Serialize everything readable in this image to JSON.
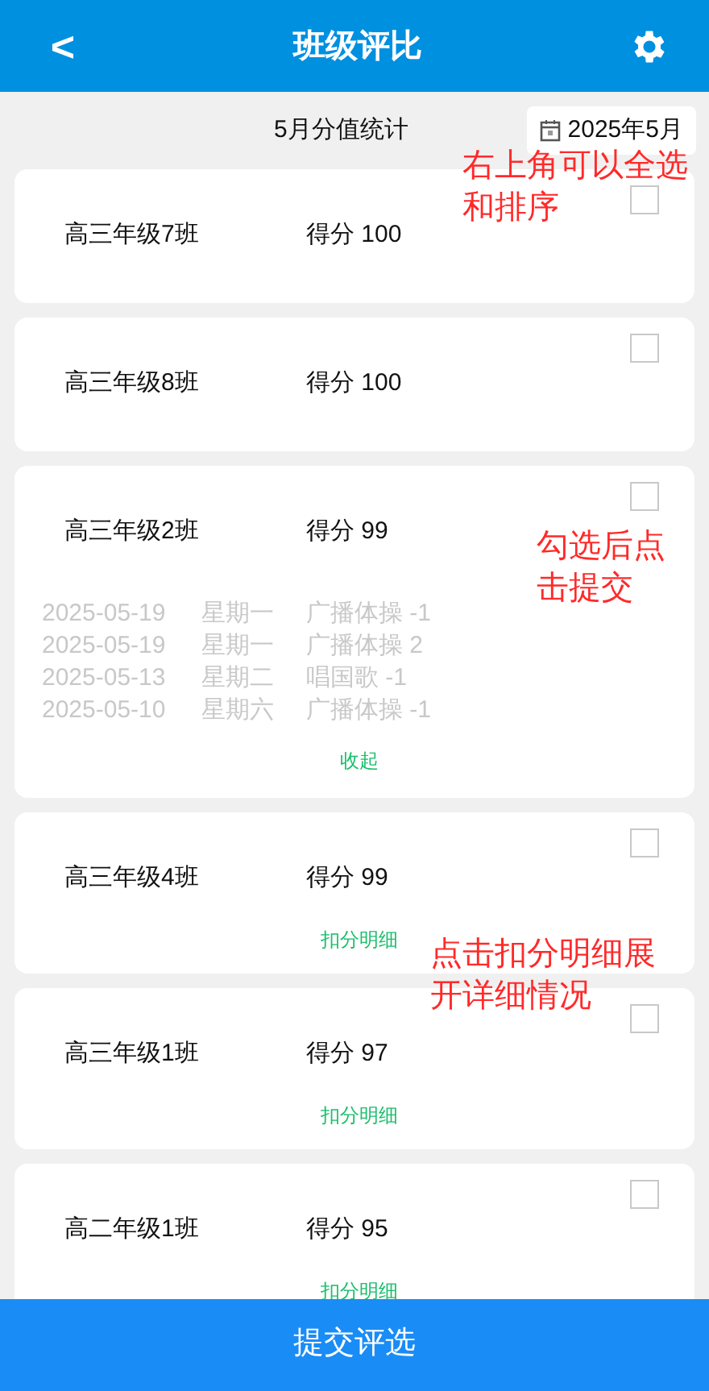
{
  "header": {
    "back": "<",
    "title": "班级评比"
  },
  "summary": {
    "title": "5月分值统计",
    "month": "2025年5月"
  },
  "classes": [
    {
      "name": "高三年级7班",
      "score": "得分 100",
      "checked": false
    },
    {
      "name": "高三年级8班",
      "score": "得分 100",
      "checked": false
    },
    {
      "name": "高三年级2班",
      "score": "得分 99",
      "checked": false,
      "toggle": "收起",
      "details": [
        {
          "date": "2025-05-19",
          "weekday": "星期一",
          "item": "广播体操 -1"
        },
        {
          "date": "2025-05-19",
          "weekday": "星期一",
          "item": "广播体操 2"
        },
        {
          "date": "2025-05-13",
          "weekday": "星期二",
          "item": "唱国歌 -1"
        },
        {
          "date": "2025-05-10",
          "weekday": "星期六",
          "item": "广播体操 -1"
        }
      ]
    },
    {
      "name": "高三年级4班",
      "score": "得分 99",
      "checked": false,
      "toggle": "扣分明细"
    },
    {
      "name": "高三年级1班",
      "score": "得分 97",
      "checked": false,
      "toggle": "扣分明细"
    },
    {
      "name": "高二年级1班",
      "score": "得分 95",
      "checked": false,
      "toggle": "扣分明细"
    }
  ],
  "submit": "提交评选",
  "annotations": [
    {
      "lines": [
        "右上角可以全选",
        "和排序"
      ]
    },
    {
      "lines": [
        "勾选后点",
        "击提交"
      ]
    },
    {
      "lines": [
        "点击扣分明细展",
        "开详细情况"
      ]
    }
  ]
}
